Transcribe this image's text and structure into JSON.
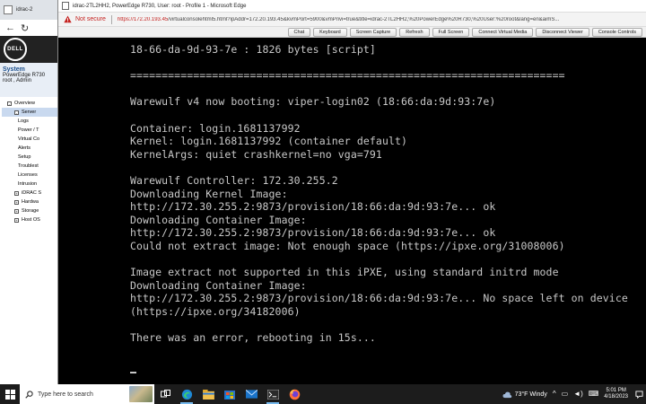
{
  "background_browser": {
    "tab_title": "idrac-2",
    "system_title": "System",
    "system_model": "PowerEdge R730",
    "system_user": "root , Admin",
    "tree": [
      {
        "label": "Overview",
        "level": "l1",
        "toggle": "-"
      },
      {
        "label": "Server",
        "level": "l1b",
        "toggle": "-",
        "selected": true
      },
      {
        "label": "Logs",
        "level": "l2"
      },
      {
        "label": "Power / T",
        "level": "l2"
      },
      {
        "label": "Virtual Co",
        "level": "l2"
      },
      {
        "label": "Alerts",
        "level": "l2"
      },
      {
        "label": "Setup",
        "level": "l2"
      },
      {
        "label": "Troublest",
        "level": "l2"
      },
      {
        "label": "Licenses",
        "level": "l2"
      },
      {
        "label": "Intrusion",
        "level": "l2"
      },
      {
        "label": "iDRAC S",
        "level": "l1b",
        "toggle": "+"
      },
      {
        "label": "Hardwa",
        "level": "l1b",
        "toggle": "+"
      },
      {
        "label": "Storage",
        "level": "l1b",
        "toggle": "+"
      },
      {
        "label": "Host OS",
        "level": "l1b",
        "toggle": "+"
      }
    ]
  },
  "window": {
    "title": "idrac-2TL2HH2, PowerEdge R730, User: root - Profile 1 - Microsoft Edge",
    "not_secure": "Not secure",
    "url_host": "https://172.20.193.45",
    "url_rest": "/virtualconsolehtml5.html?ipAddr=172.20.193.45&kvmPort=5900&vmPrivi=true&title=idrac-2TL2HH2,%20PowerEdge%20R730,%20User:%20root&lang=en&aimS..."
  },
  "console_toolbar": [
    "Chat",
    "Keyboard",
    "Screen Capture",
    "Refresh",
    "Full Screen",
    "Connect Virtual Media",
    "Disconnect Viewer",
    "Console Controls"
  ],
  "console": {
    "lines": [
      "18-66-da-9d-93-7e : 1826 bytes [script]",
      "",
      "=====================================================================",
      "",
      "Warewulf v4 now booting: viper-login02 (18:66:da:9d:93:7e)",
      "",
      "Container: login.1681137992",
      "Kernel: login.1681137992 (container default)",
      "KernelArgs: quiet crashkernel=no vga=791",
      "",
      "Warewulf Controller: 172.30.255.2",
      "Downloading Kernel Image:",
      "http://172.30.255.2:9873/provision/18:66:da:9d:93:7e... ok",
      "Downloading Container Image:",
      "http://172.30.255.2:9873/provision/18:66:da:9d:93:7e... ok",
      "Could not extract image: Not enough space (https://ipxe.org/31008006)",
      "",
      "Image extract not supported in this iPXE, using standard initrd mode",
      "Downloading Container Image:",
      "http://172.30.255.2:9873/provision/18:66:da:9d:93:7e... No space left on device",
      "(https://ipxe.org/34182006)",
      "",
      "There was an error, rebooting in 15s..."
    ]
  },
  "taskbar": {
    "search_placeholder": "Type here to search",
    "weather": "73°F  Windy",
    "time": "5:01 PM",
    "date": "4/18/2023"
  }
}
